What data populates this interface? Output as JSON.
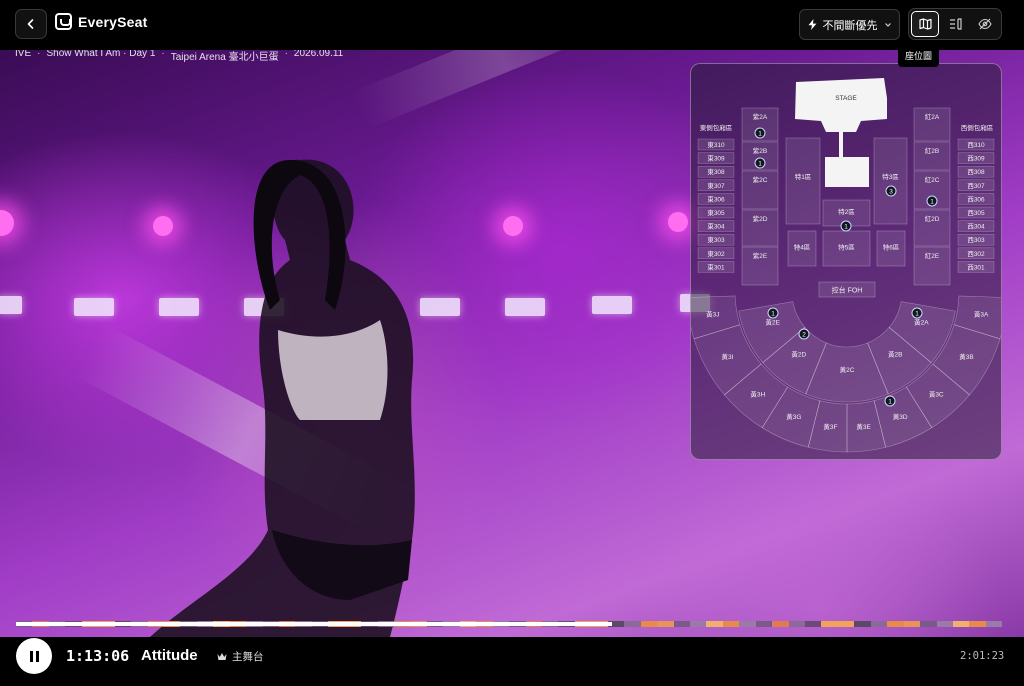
{
  "app": {
    "name": "EverySeat"
  },
  "header": {
    "priority_label": "不間斷優先",
    "tooltip": "座位圖",
    "meta": [
      "IVE",
      "Show What I Am · Day 1",
      "Taipei Arena 臺北小巨蛋",
      "2026.09.11"
    ]
  },
  "seatmap": {
    "stage_label": "STAGE",
    "foh_label": "控台 FOH",
    "east_box_title": "東側包廂區",
    "west_box_title": "西側包廂區",
    "east_boxes": [
      "東310",
      "東309",
      "東308",
      "東307",
      "東306",
      "東305",
      "東304",
      "東303",
      "東302",
      "東301"
    ],
    "west_boxes": [
      "西310",
      "西309",
      "西308",
      "西307",
      "西306",
      "西305",
      "西304",
      "西303",
      "西302",
      "西301"
    ],
    "purple": [
      {
        "label": "紫2A",
        "count": "1"
      },
      {
        "label": "紫2B",
        "count": "1"
      },
      {
        "label": "紫2C",
        "count": ""
      },
      {
        "label": "紫2D",
        "count": ""
      },
      {
        "label": "紫2E",
        "count": ""
      }
    ],
    "red": [
      {
        "label": "紅2A",
        "count": ""
      },
      {
        "label": "紅2B",
        "count": ""
      },
      {
        "label": "紅2C",
        "count": "1"
      },
      {
        "label": "紅2D",
        "count": ""
      },
      {
        "label": "紅2E",
        "count": ""
      }
    ],
    "floor": [
      {
        "label": "特1區",
        "count": ""
      },
      {
        "label": "特2區",
        "count": "1"
      },
      {
        "label": "特3區",
        "count": "3"
      },
      {
        "label": "特4區",
        "count": ""
      },
      {
        "label": "特5區",
        "count": ""
      },
      {
        "label": "特6區",
        "count": ""
      }
    ],
    "yellow2": [
      {
        "label": "黃2E",
        "count": "1"
      },
      {
        "label": "黃2D",
        "count": "2"
      },
      {
        "label": "黃2C",
        "count": ""
      },
      {
        "label": "黃2B",
        "count": ""
      },
      {
        "label": "黃2A",
        "count": "1"
      }
    ],
    "yellow3": [
      {
        "label": "黃3J",
        "count": ""
      },
      {
        "label": "黃3I",
        "count": ""
      },
      {
        "label": "黃3H",
        "count": ""
      },
      {
        "label": "黃3G",
        "count": ""
      },
      {
        "label": "黃3F",
        "count": ""
      },
      {
        "label": "黃3E",
        "count": ""
      },
      {
        "label": "黃3D",
        "count": "1"
      },
      {
        "label": "黃3C",
        "count": ""
      },
      {
        "label": "黃3B",
        "count": ""
      },
      {
        "label": "黃3A",
        "count": ""
      }
    ]
  },
  "player": {
    "current_time": "1:13:06",
    "song": "Attitude",
    "stage_name": "主舞台",
    "total_time": "2:01:23",
    "progress": 0.604
  },
  "colors": {
    "accent": "#f2a35a",
    "progress_played": "#ffffff"
  }
}
